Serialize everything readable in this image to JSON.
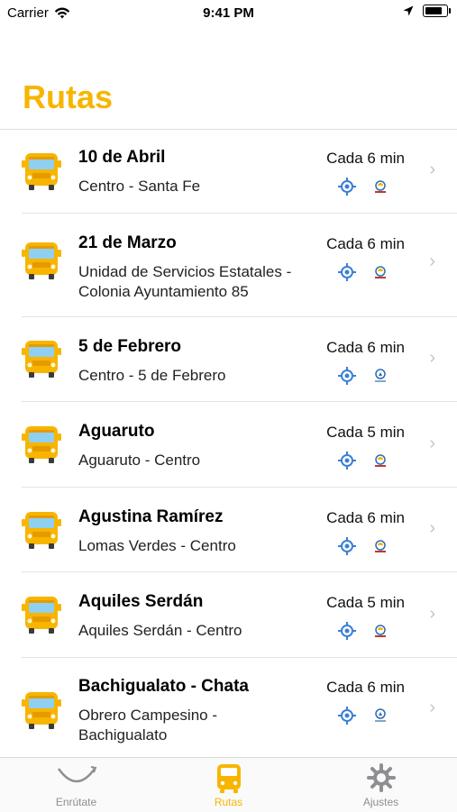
{
  "status_bar": {
    "carrier": "Carrier",
    "time": "9:41 PM"
  },
  "page": {
    "title": "Rutas"
  },
  "routes": [
    {
      "name": "10 de Abril",
      "description": "Centro - Santa Fe",
      "frequency": "Cada 6 min"
    },
    {
      "name": "21 de Marzo",
      "description": "Unidad de Servicios Estatales - Colonia Ayuntamiento 85",
      "frequency": "Cada 6 min"
    },
    {
      "name": "5 de Febrero",
      "description": "Centro - 5 de Febrero",
      "frequency": "Cada 6 min"
    },
    {
      "name": "Aguaruto",
      "description": "Aguaruto - Centro",
      "frequency": "Cada 5 min"
    },
    {
      "name": "Agustina Ramírez",
      "description": "Lomas Verdes - Centro",
      "frequency": "Cada 6 min"
    },
    {
      "name": "Aquiles Serdán",
      "description": "Aquiles Serdán - Centro",
      "frequency": "Cada 5 min"
    },
    {
      "name": "Bachigualato - Chata",
      "description": "Obrero Campesino - Bachigualato",
      "frequency": "Cada 6 min"
    }
  ],
  "tab_bar": {
    "tabs": [
      {
        "label": "Enrútate",
        "icon": "route-arc-icon"
      },
      {
        "label": "Rutas",
        "icon": "bus-icon"
      },
      {
        "label": "Ajustes",
        "icon": "gear-icon"
      }
    ],
    "active": "Rutas"
  },
  "colors": {
    "accent": "#f7b500",
    "locate": "#3a7fd5",
    "inactive": "#8e8e93"
  }
}
